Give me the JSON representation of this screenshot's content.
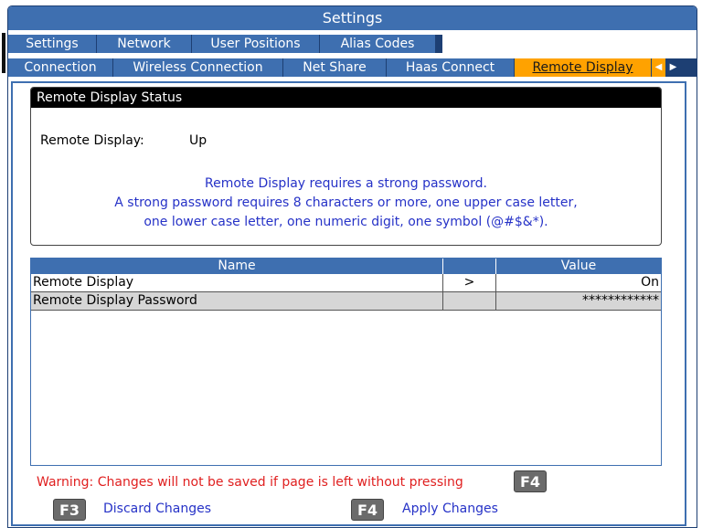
{
  "window": {
    "title": "Settings"
  },
  "tabs_row1": [
    "Settings",
    "Network",
    "User Positions",
    "Alias Codes"
  ],
  "tabs_row2": [
    "Connection",
    "Wireless Connection",
    "Net Share",
    "Haas Connect",
    "Remote Display"
  ],
  "status": {
    "header": "Remote Display Status",
    "label": "Remote Display:",
    "value": "Up",
    "msg1": "Remote Display requires a strong password.",
    "msg2": "A strong password requires 8 characters or more, one upper case letter,",
    "msg3": "one lower case letter, one numeric digit, one symbol (@#$&*)."
  },
  "table": {
    "headers": {
      "name": "Name",
      "value": "Value"
    },
    "rows": [
      {
        "name": "Remote Display",
        "arrow": ">",
        "value": "On"
      },
      {
        "name": "Remote Display Password",
        "arrow": "",
        "value": "************"
      }
    ]
  },
  "footer": {
    "warning": "Warning: Changes will not be saved if page is left without pressing",
    "warn_key": "F4",
    "f3_key": "F3",
    "f3_label": "Discard Changes",
    "f4_key": "F4",
    "f4_label": "Apply Changes"
  },
  "colors": {
    "accent": "#3e6fb0",
    "active_tab": "#ffa200",
    "info_text": "#2632c7",
    "warning_text": "#e02020"
  }
}
